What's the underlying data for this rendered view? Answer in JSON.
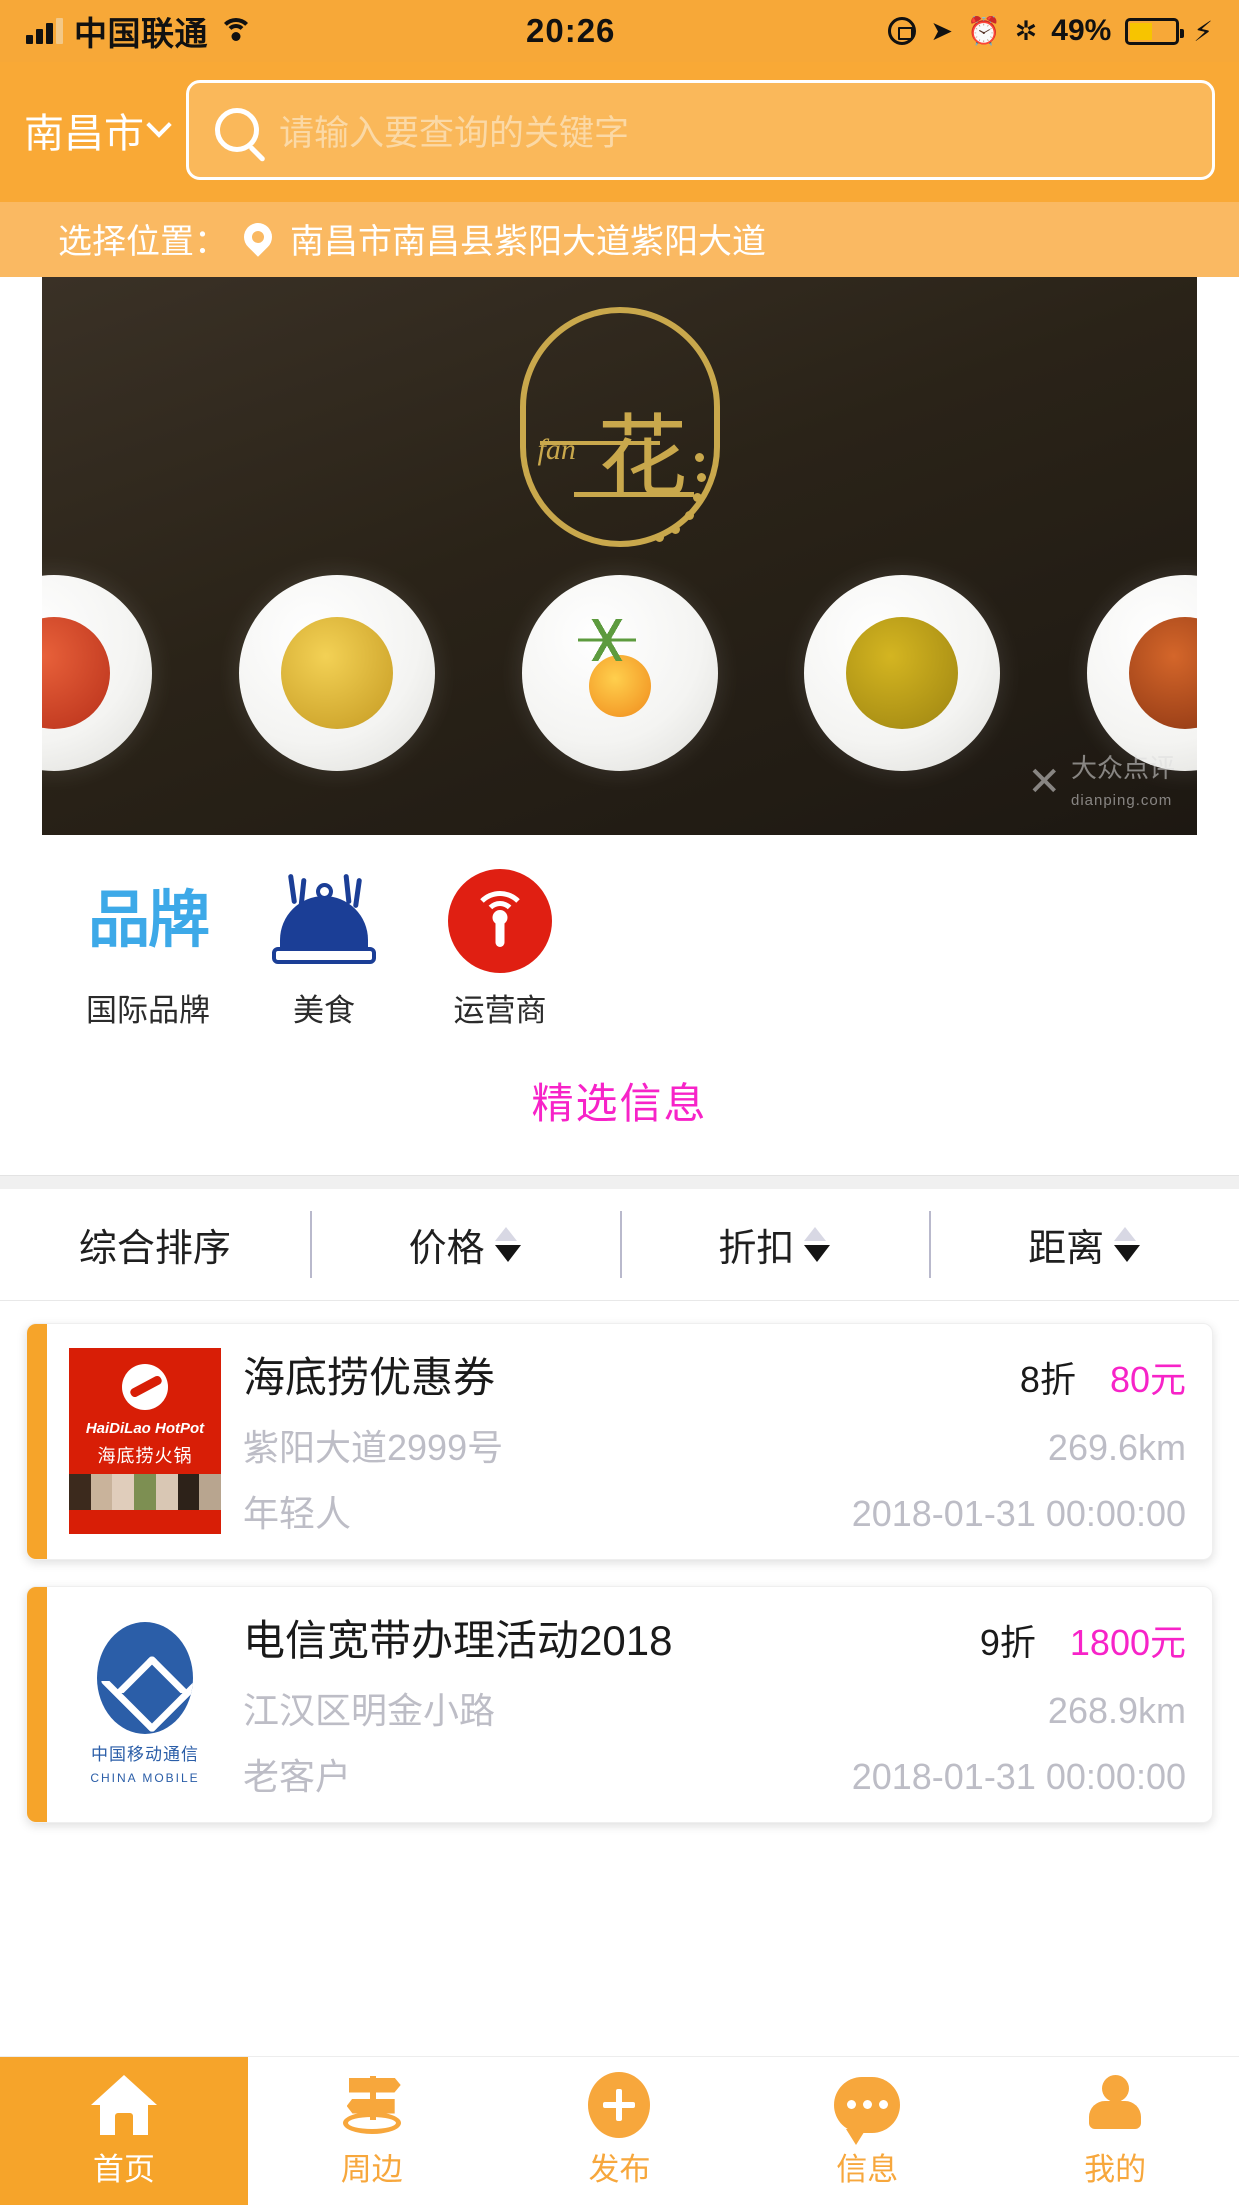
{
  "status_bar": {
    "carrier": "中国联通",
    "time": "20:26",
    "battery_percent": "49%",
    "icons": [
      "signal-bars-icon",
      "wifi-icon",
      "rotation-lock-icon",
      "location-arrow-icon",
      "alarm-clock-icon",
      "bluetooth-icon",
      "battery-icon",
      "charging-bolt-icon"
    ]
  },
  "header": {
    "city": "南昌市",
    "city_chevron": "chevron-down-icon",
    "search_placeholder": "请输入要查询的关键字",
    "search_value": "",
    "accent_color": "#F9A936"
  },
  "location_bar": {
    "label": "选择位置：",
    "pin_icon": "map-pin-icon",
    "address": "南昌市南昌县紫阳大道紫阳大道"
  },
  "banner": {
    "alt": "restaurant-food-plates-banner",
    "logo_text_latin": "fan",
    "logo_text_cn": "花",
    "watermark": "大众点评",
    "watermark_sub": "dianping.com"
  },
  "categories": [
    {
      "label": "国际品牌",
      "icon": "brand-text-icon",
      "icon_text": "品牌",
      "color": "#3DA9E8"
    },
    {
      "label": "美食",
      "icon": "food-cloche-icon",
      "color": "#1B3E96"
    },
    {
      "label": "运营商",
      "icon": "signal-tower-icon",
      "color": "#E01F12"
    }
  ],
  "featured": {
    "title": "精选信息",
    "color": "#F723C8"
  },
  "sort_bar": [
    {
      "label": "综合排序",
      "has_arrows": false
    },
    {
      "label": "价格",
      "has_arrows": true
    },
    {
      "label": "折扣",
      "has_arrows": true
    },
    {
      "label": "距离",
      "has_arrows": true
    }
  ],
  "results": [
    {
      "thumb": "haidilao-hotpot-logo",
      "thumb_en": "HaiDiLao HotPot",
      "thumb_cn": "海底捞火锅",
      "title": "海底捞优惠券",
      "discount": "8折",
      "price": "80元",
      "address": "紫阳大道2999号",
      "distance": "269.6km",
      "tag": "年轻人",
      "date": "2018-01-31 00:00:00"
    },
    {
      "thumb": "china-mobile-logo",
      "thumb_en": "CHINA MOBILE",
      "thumb_cn": "中国移动通信",
      "title": "电信宽带办理活动2018",
      "discount": "9折",
      "price": "1800元",
      "address": "江汉区明金小路",
      "distance": "268.9km",
      "tag": "老客户",
      "date": "2018-01-31 00:00:00"
    }
  ],
  "tab_bar": [
    {
      "label": "首页",
      "icon": "home-icon",
      "active": true
    },
    {
      "label": "周边",
      "icon": "signpost-icon",
      "active": false
    },
    {
      "label": "发布",
      "icon": "plus-circle-icon",
      "active": false
    },
    {
      "label": "信息",
      "icon": "chat-bubble-icon",
      "active": false
    },
    {
      "label": "我的",
      "icon": "person-icon",
      "active": false
    }
  ]
}
